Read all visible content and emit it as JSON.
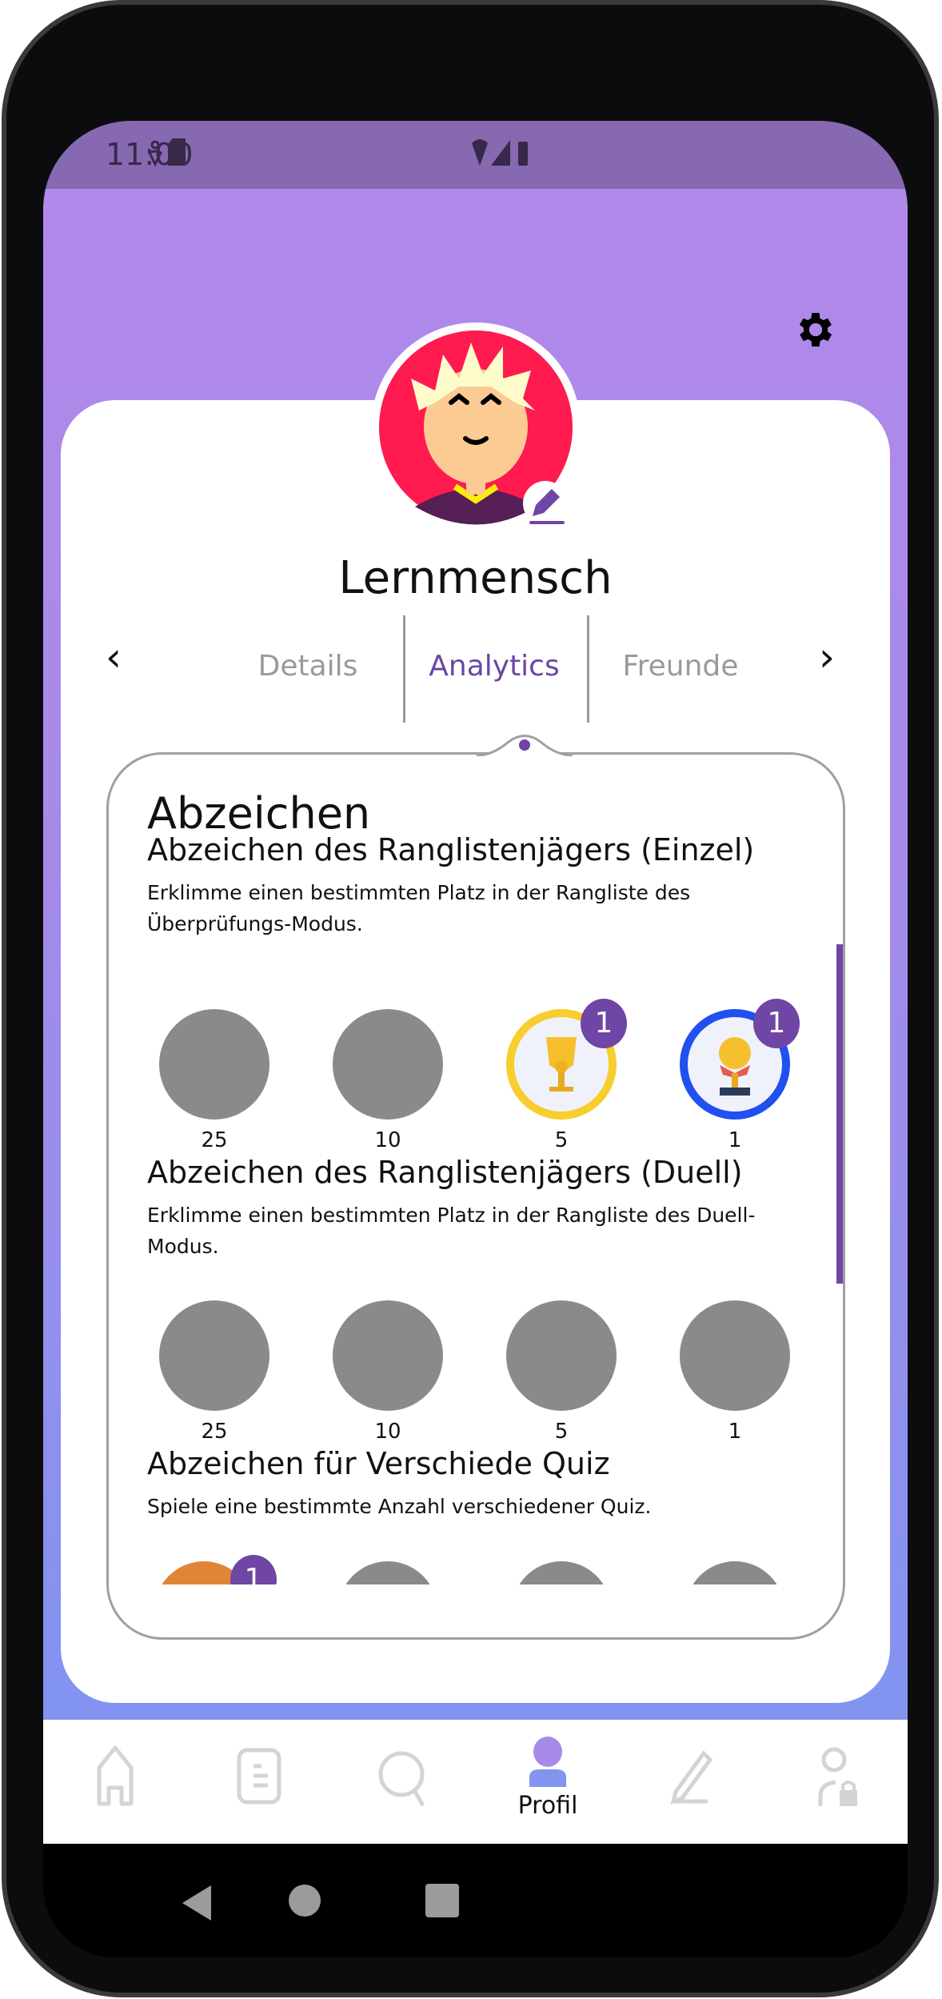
{
  "status_bar": {
    "time": "11:00",
    "icons": [
      "accessibility-icon",
      "sd-card-icon",
      "wifi-icon",
      "signal-icon",
      "battery-icon"
    ]
  },
  "profile": {
    "name": "Lernmensch",
    "avatar": "avatar-illustration",
    "edit_icon": "pencil-icon",
    "settings_icon": "gear-icon"
  },
  "tabs": [
    {
      "label": "Details",
      "active": false
    },
    {
      "label": "Analytics",
      "active": true
    },
    {
      "label": "Freunde",
      "active": false
    }
  ],
  "panel": {
    "title": "Abzeichen",
    "sections": [
      {
        "title": "Abzeichen des Ranglistenjägers (Einzel)",
        "description": "Erklimme einen bestimmten Platz in der Rangliste des Überprüfungs-Modus.",
        "badges": [
          {
            "label": "25",
            "earned": false
          },
          {
            "label": "10",
            "earned": false
          },
          {
            "label": "5",
            "earned": true,
            "count": "1"
          },
          {
            "label": "1",
            "earned": true,
            "count": "1"
          }
        ]
      },
      {
        "title": "Abzeichen des Ranglistenjägers (Duell)",
        "description": "Erklimme einen bestimmten Platz in der Rangliste des Duell-Modus.",
        "badges": [
          {
            "label": "25",
            "earned": false
          },
          {
            "label": "10",
            "earned": false
          },
          {
            "label": "5",
            "earned": false
          },
          {
            "label": "1",
            "earned": false
          }
        ]
      },
      {
        "title": "Abzeichen für Verschiede Quiz",
        "description": "Spiele eine bestimmte Anzahl verschiedener Quiz.",
        "badges": [
          {
            "earned": true,
            "count": "1"
          },
          {
            "earned": false
          },
          {
            "earned": false
          },
          {
            "earned": false
          }
        ]
      }
    ]
  },
  "bottom_nav": {
    "items": [
      {
        "icon": "home-icon"
      },
      {
        "icon": "list-icon"
      },
      {
        "icon": "search-icon"
      },
      {
        "icon": "profile-icon",
        "label": "Profil",
        "active": true
      },
      {
        "icon": "pencil-icon"
      },
      {
        "icon": "user-lock-icon"
      }
    ]
  },
  "colors": {
    "accent": "#6f45a5",
    "gradient_top": "#b089ea",
    "gradient_bottom": "#8293f0",
    "avatar_bg": "#ff1a4f"
  }
}
